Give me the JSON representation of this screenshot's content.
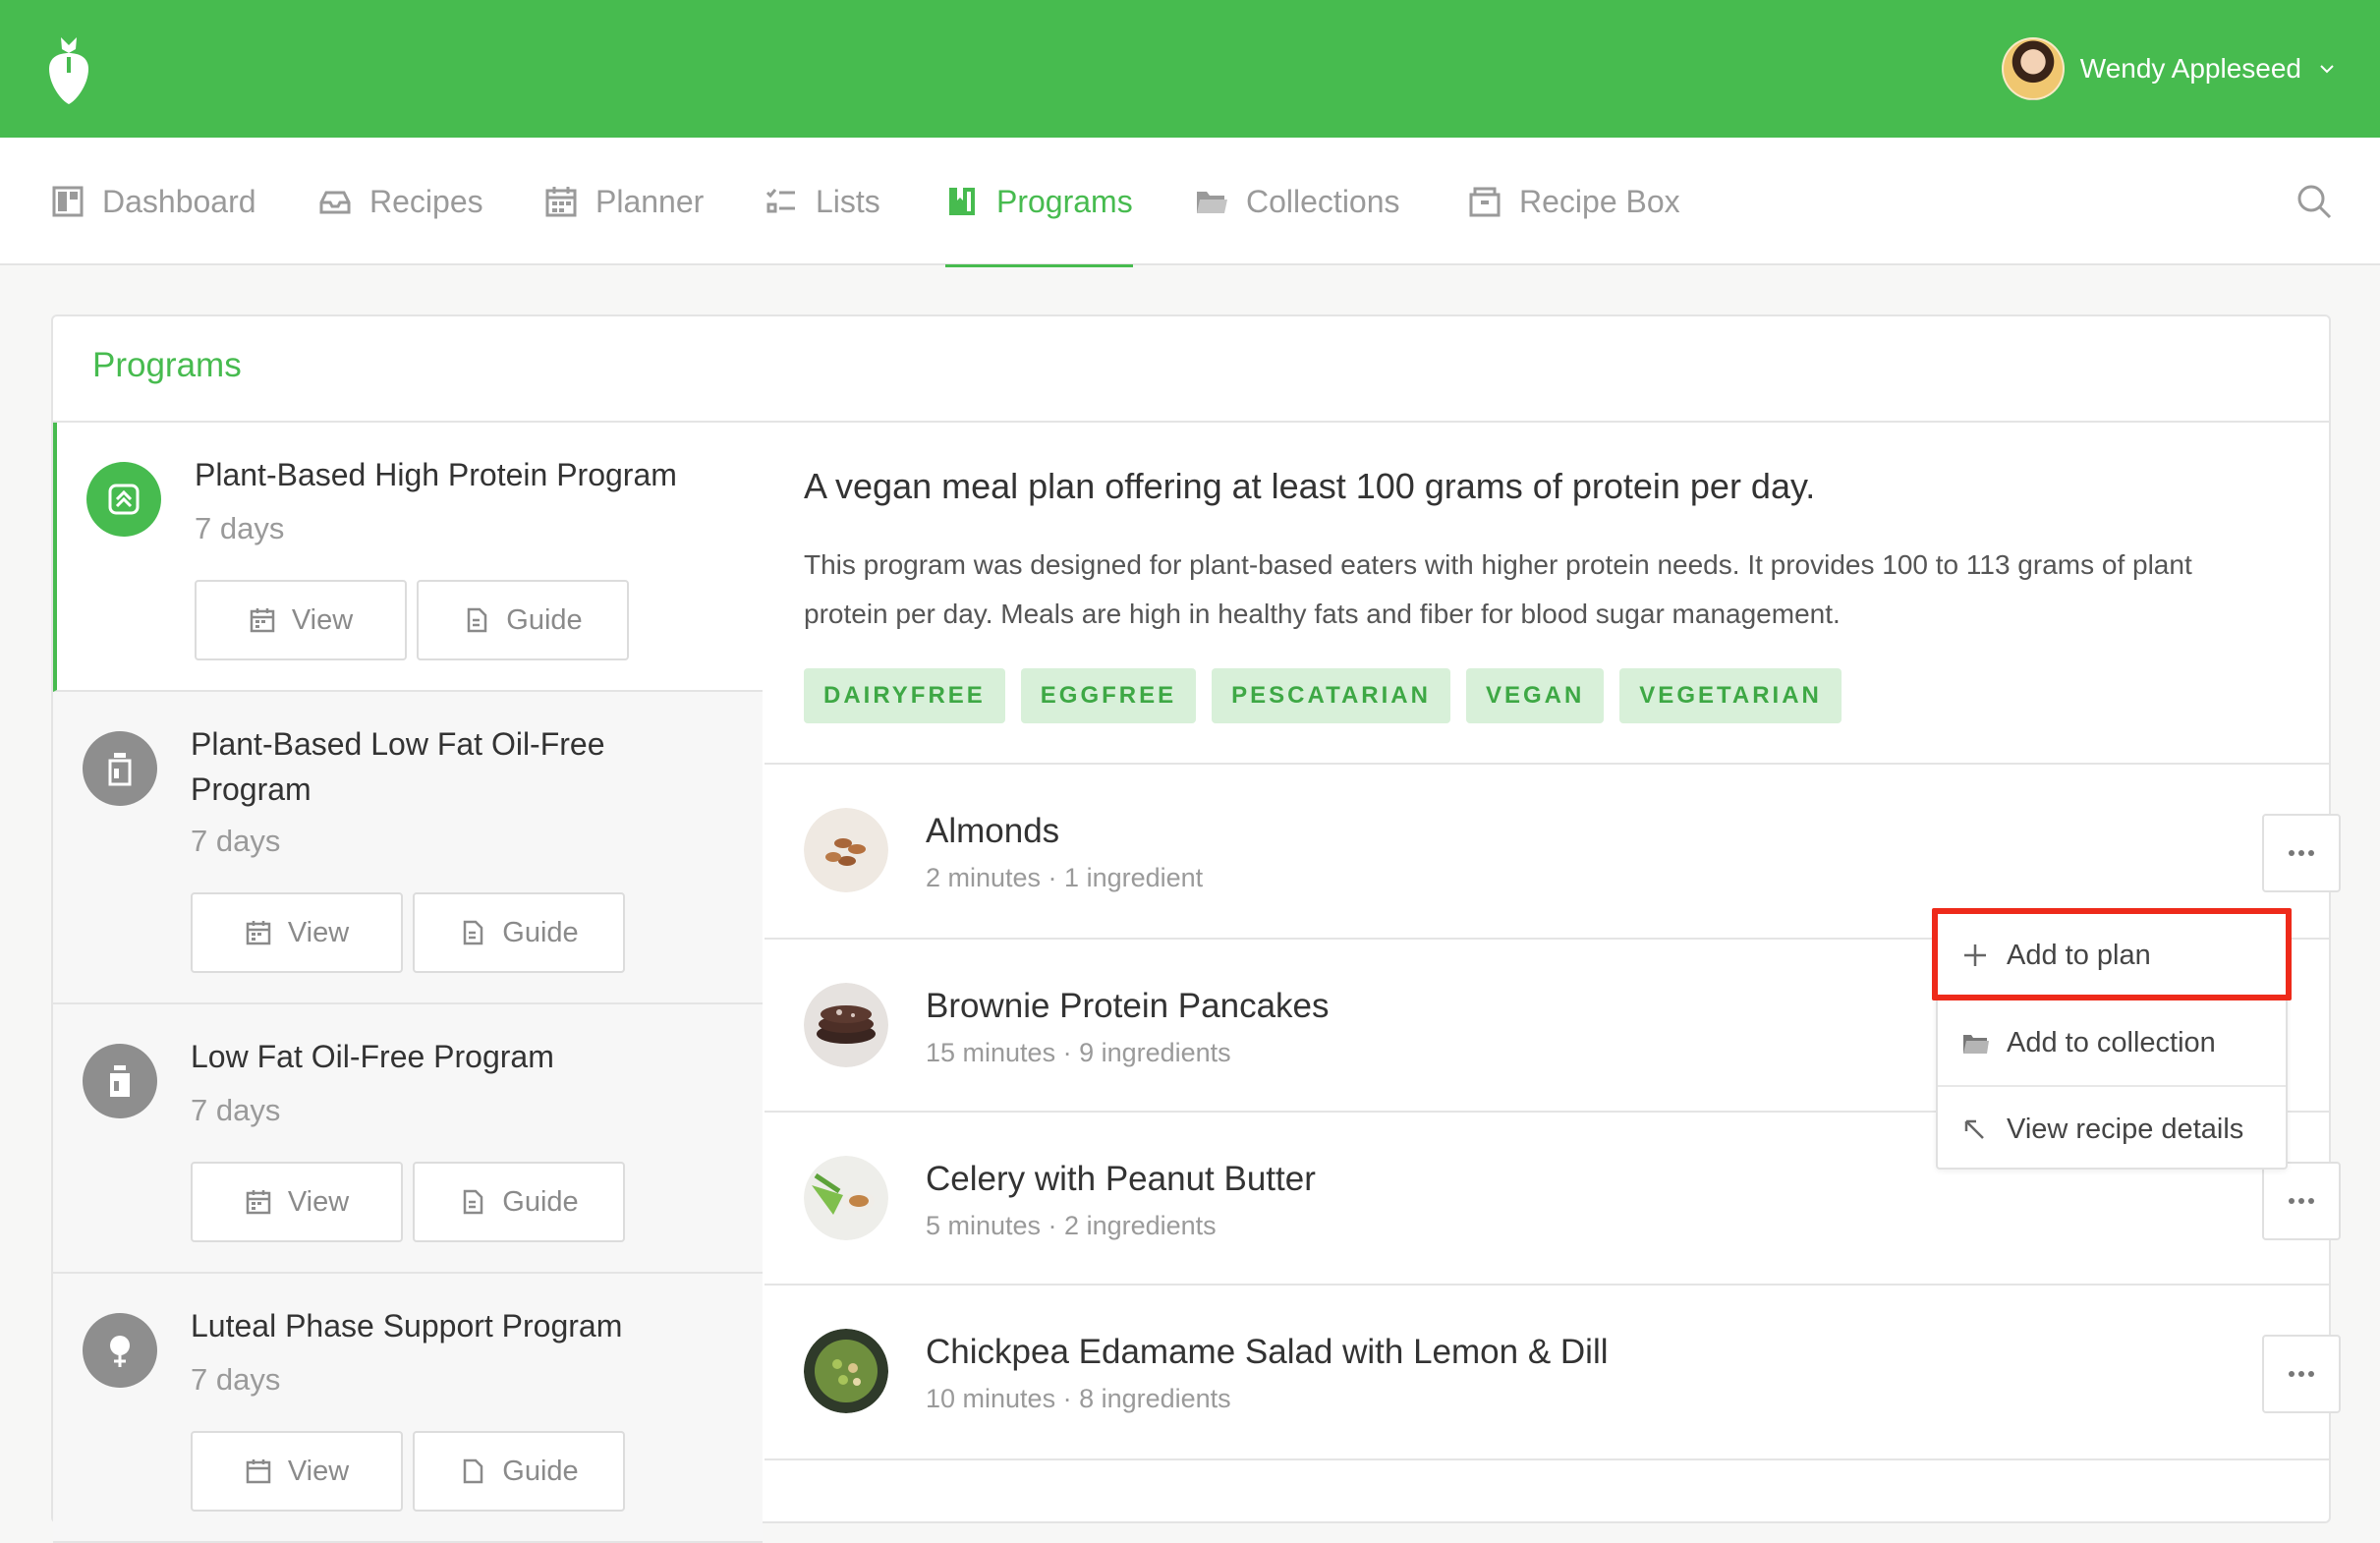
{
  "header": {
    "logo_icon": "strawberry-logo-icon",
    "user_name": "Wendy Appleseed",
    "brand_color": "#47bb4f"
  },
  "nav": {
    "items": [
      {
        "label": "Dashboard",
        "icon": "dashboard-icon"
      },
      {
        "label": "Recipes",
        "icon": "recipes-tray-icon"
      },
      {
        "label": "Planner",
        "icon": "calendar-icon"
      },
      {
        "label": "Lists",
        "icon": "checklist-icon"
      },
      {
        "label": "Programs",
        "icon": "programs-icon",
        "active": true
      },
      {
        "label": "Collections",
        "icon": "folder-icon"
      },
      {
        "label": "Recipe Box",
        "icon": "box-icon"
      }
    ],
    "search_icon": "search-icon"
  },
  "panel": {
    "title": "Programs"
  },
  "programs": [
    {
      "title": "Plant-Based High Protein Program",
      "days": "7 days",
      "view_label": "View",
      "guide_label": "Guide",
      "active": true
    },
    {
      "title": "Plant-Based Low Fat Oil-Free Program",
      "days": "7 days",
      "view_label": "View",
      "guide_label": "Guide"
    },
    {
      "title": "Low Fat Oil-Free Program",
      "days": "7 days",
      "view_label": "View",
      "guide_label": "Guide"
    },
    {
      "title": "Luteal Phase Support Program",
      "days": "7 days",
      "view_label": "View",
      "guide_label": "Guide"
    }
  ],
  "detail": {
    "title": "A vegan meal plan offering at least 100 grams of protein per day.",
    "description": "This program was designed for plant-based eaters with higher protein needs. It provides 100 to 113 grams of plant protein per day. Meals are high in healthy fats and fiber for blood sugar management.",
    "tags": [
      "DAIRYFREE",
      "EGGFREE",
      "PESCATARIAN",
      "VEGAN",
      "VEGETARIAN"
    ]
  },
  "recipes": [
    {
      "title": "Almonds",
      "meta": "2 minutes · 1 ingredient"
    },
    {
      "title": "Brownie Protein Pancakes",
      "meta": "15 minutes · 9 ingredients"
    },
    {
      "title": "Celery with Peanut Butter",
      "meta": "5 minutes · 2 ingredients"
    },
    {
      "title": "Chickpea Edamame Salad with Lemon & Dill",
      "meta": "10 minutes · 8 ingredients"
    }
  ],
  "dropdown": {
    "items": [
      {
        "label": "Add to plan",
        "icon": "plus-icon"
      },
      {
        "label": "Add to collection",
        "icon": "collection-icon"
      },
      {
        "label": "View recipe details",
        "icon": "arrow-up-left-icon"
      }
    ],
    "highlight_color": "#ee2a1a"
  }
}
